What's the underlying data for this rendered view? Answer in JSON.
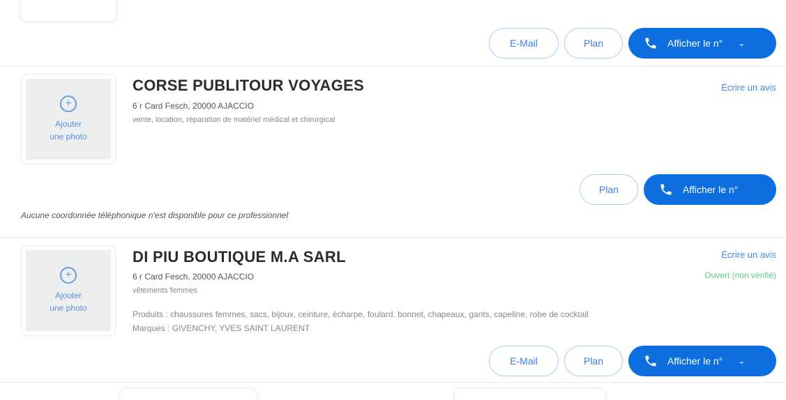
{
  "buttons": {
    "email": "E-Mail",
    "plan": "Plan",
    "show_phone": "Afficher le n°"
  },
  "photo_placeholder": {
    "line1": "Ajouter",
    "line2": "une photo"
  },
  "listings": [
    {
      "name": "CORSE PUBLITOUR VOYAGES",
      "address": "6 r Card Fesch, 20000 AJACCIO",
      "category": "vente, location, réparation de matériel médical et chirurgical",
      "review_link": "Écrire un avis"
    },
    {
      "name": "DI PIU BOUTIQUE M.A SARL",
      "address": "6 r Card Fesch, 20000 AJACCIO",
      "category": "vêtements femmes",
      "products": "Produits : chaussures femmes, sacs, bijoux, ceinture, écharpe, foulard, bonnet, chapeaux, gants, capeline, robe de cocktail",
      "brands": "Marques : GIVENCHY, YVES SAINT LAURENT",
      "review_link": "Écrire un avis",
      "open_status": "Ouvert (non vérifié)"
    }
  ],
  "no_phone_notice": "Aucune coordonnée téléphonique n'est disponible pour ce professionnel"
}
